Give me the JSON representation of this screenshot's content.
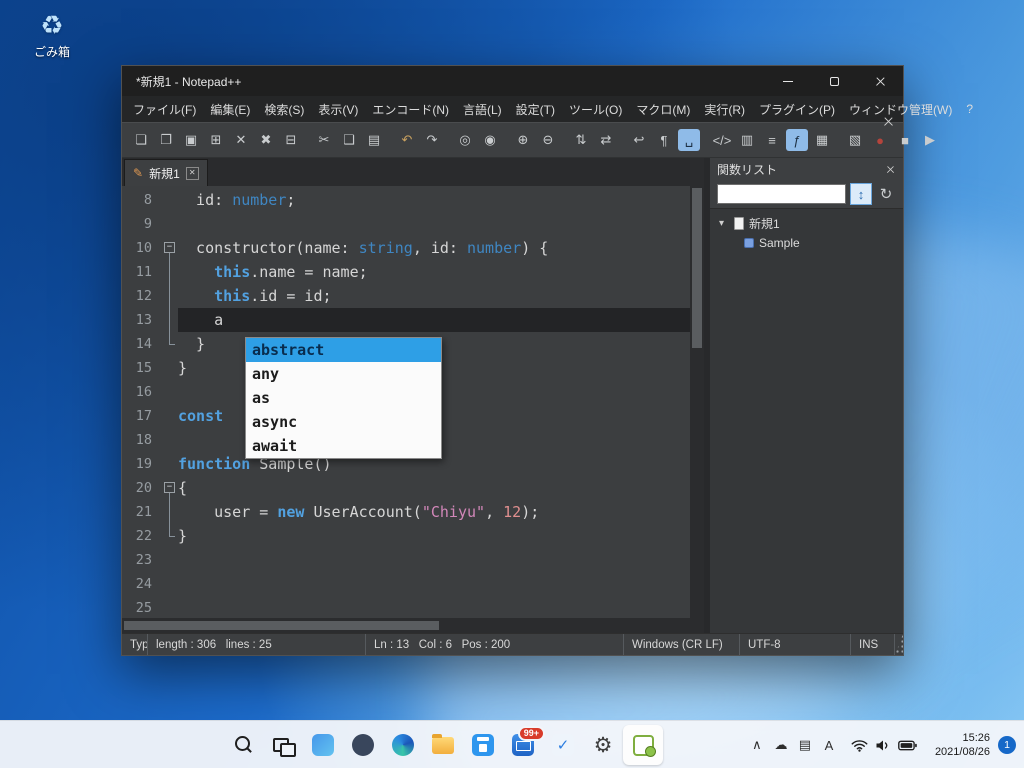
{
  "desktop": {
    "recycle_bin_label": "ごみ箱",
    "recycle_bin_glyph": "♻"
  },
  "window": {
    "title": "*新規1 - Notepad++"
  },
  "menu": {
    "items": [
      "ファイル(F)",
      "編集(E)",
      "検索(S)",
      "表示(V)",
      "エンコード(N)",
      "言語(L)",
      "設定(T)",
      "ツール(O)",
      "マクロ(M)",
      "実行(R)",
      "プラグイン(P)",
      "ウィンドウ管理(W)",
      "?"
    ]
  },
  "toolbar": {
    "buttons": [
      {
        "name": "new-file",
        "glyph": "❏"
      },
      {
        "name": "open-file",
        "glyph": "❐"
      },
      {
        "name": "save-file",
        "glyph": "▣"
      },
      {
        "name": "save-all",
        "glyph": "⊞"
      },
      {
        "name": "close-file",
        "glyph": "✕"
      },
      {
        "name": "close-all",
        "glyph": "✖"
      },
      {
        "name": "print",
        "glyph": "⊟"
      },
      {
        "name": "cut",
        "glyph": "✂",
        "gap": true
      },
      {
        "name": "copy",
        "glyph": "❑"
      },
      {
        "name": "paste",
        "glyph": "▤"
      },
      {
        "name": "undo",
        "glyph": "↶",
        "color": "#c9a15f",
        "gap": true
      },
      {
        "name": "redo",
        "glyph": "↷"
      },
      {
        "name": "find",
        "glyph": "◎",
        "gap": true
      },
      {
        "name": "replace",
        "glyph": "◉"
      },
      {
        "name": "zoom-in",
        "glyph": "⊕",
        "gap": true
      },
      {
        "name": "zoom-out",
        "glyph": "⊖"
      },
      {
        "name": "sync-vertical-scroll",
        "glyph": "⇅",
        "gap": true
      },
      {
        "name": "sync-horizontal-scroll",
        "glyph": "⇄"
      },
      {
        "name": "word-wrap",
        "glyph": "↩",
        "gap": true
      },
      {
        "name": "show-all-characters",
        "glyph": "¶"
      },
      {
        "name": "show-whitespace",
        "glyph": "␣",
        "pressed": true
      },
      {
        "name": "define-language",
        "glyph": "</>",
        "gap": true
      },
      {
        "name": "document-map",
        "glyph": "▥"
      },
      {
        "name": "document-list",
        "glyph": "≡"
      },
      {
        "name": "function-list",
        "glyph": "ƒ",
        "pressed": true
      },
      {
        "name": "folder-as-workspace",
        "glyph": "▦"
      },
      {
        "name": "file-monitoring",
        "glyph": "▧",
        "gap": true
      },
      {
        "name": "macro-record",
        "glyph": "●",
        "color": "#b5443c"
      },
      {
        "name": "macro-stop",
        "glyph": "■"
      },
      {
        "name": "macro-play",
        "glyph": "▶"
      }
    ]
  },
  "tabbar": {
    "edit_icon_glyph": "✎",
    "close_icon_glyph": "✕",
    "tabs": [
      {
        "label": "新規1",
        "active": true
      }
    ]
  },
  "editor": {
    "lines": [
      {
        "num": "8",
        "fold": "",
        "segments": [
          {
            "t": "  id: ",
            "c": "pl"
          },
          {
            "t": "number",
            "c": "ty"
          },
          {
            "t": ";",
            "c": "pl"
          }
        ]
      },
      {
        "num": "9",
        "fold": "",
        "segments": []
      },
      {
        "num": "10",
        "fold": "start",
        "segments": [
          {
            "t": "  constructor(name: ",
            "c": "pl"
          },
          {
            "t": "string",
            "c": "ty"
          },
          {
            "t": ", id: ",
            "c": "pl"
          },
          {
            "t": "number",
            "c": "ty"
          },
          {
            "t": ") {",
            "c": "pl"
          }
        ]
      },
      {
        "num": "11",
        "fold": "mid",
        "segments": [
          {
            "t": "    ",
            "c": "pl"
          },
          {
            "t": "this",
            "c": "kw"
          },
          {
            "t": ".name = name;",
            "c": "pl"
          }
        ]
      },
      {
        "num": "12",
        "fold": "mid",
        "segments": [
          {
            "t": "    ",
            "c": "pl"
          },
          {
            "t": "this",
            "c": "kw"
          },
          {
            "t": ".id = id;",
            "c": "pl"
          }
        ]
      },
      {
        "num": "13",
        "fold": "mid",
        "current": true,
        "segments": [
          {
            "t": "    a",
            "c": "pl"
          }
        ]
      },
      {
        "num": "14",
        "fold": "end",
        "segments": [
          {
            "t": "  }",
            "c": "pl"
          }
        ]
      },
      {
        "num": "15",
        "fold": "",
        "segments": [
          {
            "t": "}",
            "c": "pl"
          }
        ]
      },
      {
        "num": "16",
        "fold": "",
        "segments": []
      },
      {
        "num": "17",
        "fold": "",
        "segments": [
          {
            "t": "const",
            "c": "kw"
          }
        ]
      },
      {
        "num": "18",
        "fold": "",
        "segments": []
      },
      {
        "num": "19",
        "fold": "",
        "segments": [
          {
            "t": "function",
            "c": "kw"
          },
          {
            "t": " Sample()",
            "c": "pl"
          }
        ]
      },
      {
        "num": "20",
        "fold": "start",
        "segments": [
          {
            "t": "{",
            "c": "pl"
          }
        ]
      },
      {
        "num": "21",
        "fold": "mid",
        "segments": [
          {
            "t": "    user = ",
            "c": "pl"
          },
          {
            "t": "new",
            "c": "kw"
          },
          {
            "t": " UserAccount(",
            "c": "pl"
          },
          {
            "t": "\"Chiyu\"",
            "c": "str"
          },
          {
            "t": ", ",
            "c": "pl"
          },
          {
            "t": "12",
            "c": "num"
          },
          {
            "t": ");",
            "c": "pl"
          }
        ]
      },
      {
        "num": "22",
        "fold": "end",
        "segments": [
          {
            "t": "}",
            "c": "pl"
          }
        ]
      },
      {
        "num": "23",
        "fold": "",
        "segments": []
      },
      {
        "num": "24",
        "fold": "",
        "segments": []
      },
      {
        "num": "25",
        "fold": "",
        "segments": []
      }
    ]
  },
  "autocomplete": {
    "selected_index": 0,
    "items": [
      "abstract",
      "any",
      "as",
      "async",
      "await"
    ]
  },
  "function_list": {
    "title": "関数リスト",
    "search_value": "",
    "sort_icon_glyph": "↕",
    "refresh_icon_glyph": "↻",
    "expand_icon_glyph": "▾",
    "root_label": "新規1",
    "children": [
      {
        "label": "Sample"
      }
    ]
  },
  "status_bar": {
    "doc_type": "Typ",
    "length_lines": "length : 306   lines : 25",
    "caret": "Ln : 13   Col : 6   Pos : 200",
    "eol": "Windows (CR LF)",
    "encoding": "UTF-8",
    "insert_mode": "INS"
  },
  "taskbar": {
    "pinned": [
      {
        "name": "start"
      },
      {
        "name": "search"
      },
      {
        "name": "task-view"
      },
      {
        "name": "widgets"
      },
      {
        "name": "teams"
      },
      {
        "name": "edge"
      },
      {
        "name": "explorer"
      },
      {
        "name": "store"
      },
      {
        "name": "mail",
        "badge": "99+"
      },
      {
        "name": "todo",
        "glyph": "✓"
      },
      {
        "name": "settings",
        "glyph": "⚙"
      },
      {
        "name": "notepadpp",
        "active": true
      }
    ],
    "tray": [
      {
        "name": "hidden-icons",
        "glyph": "∧"
      },
      {
        "name": "onedrive",
        "glyph": "☁"
      },
      {
        "name": "touch-keyboard",
        "glyph": "▤"
      },
      {
        "name": "ime-mode",
        "glyph": "A"
      }
    ],
    "time": "15:26",
    "date": "2021/08/26",
    "notification_count": "1"
  }
}
